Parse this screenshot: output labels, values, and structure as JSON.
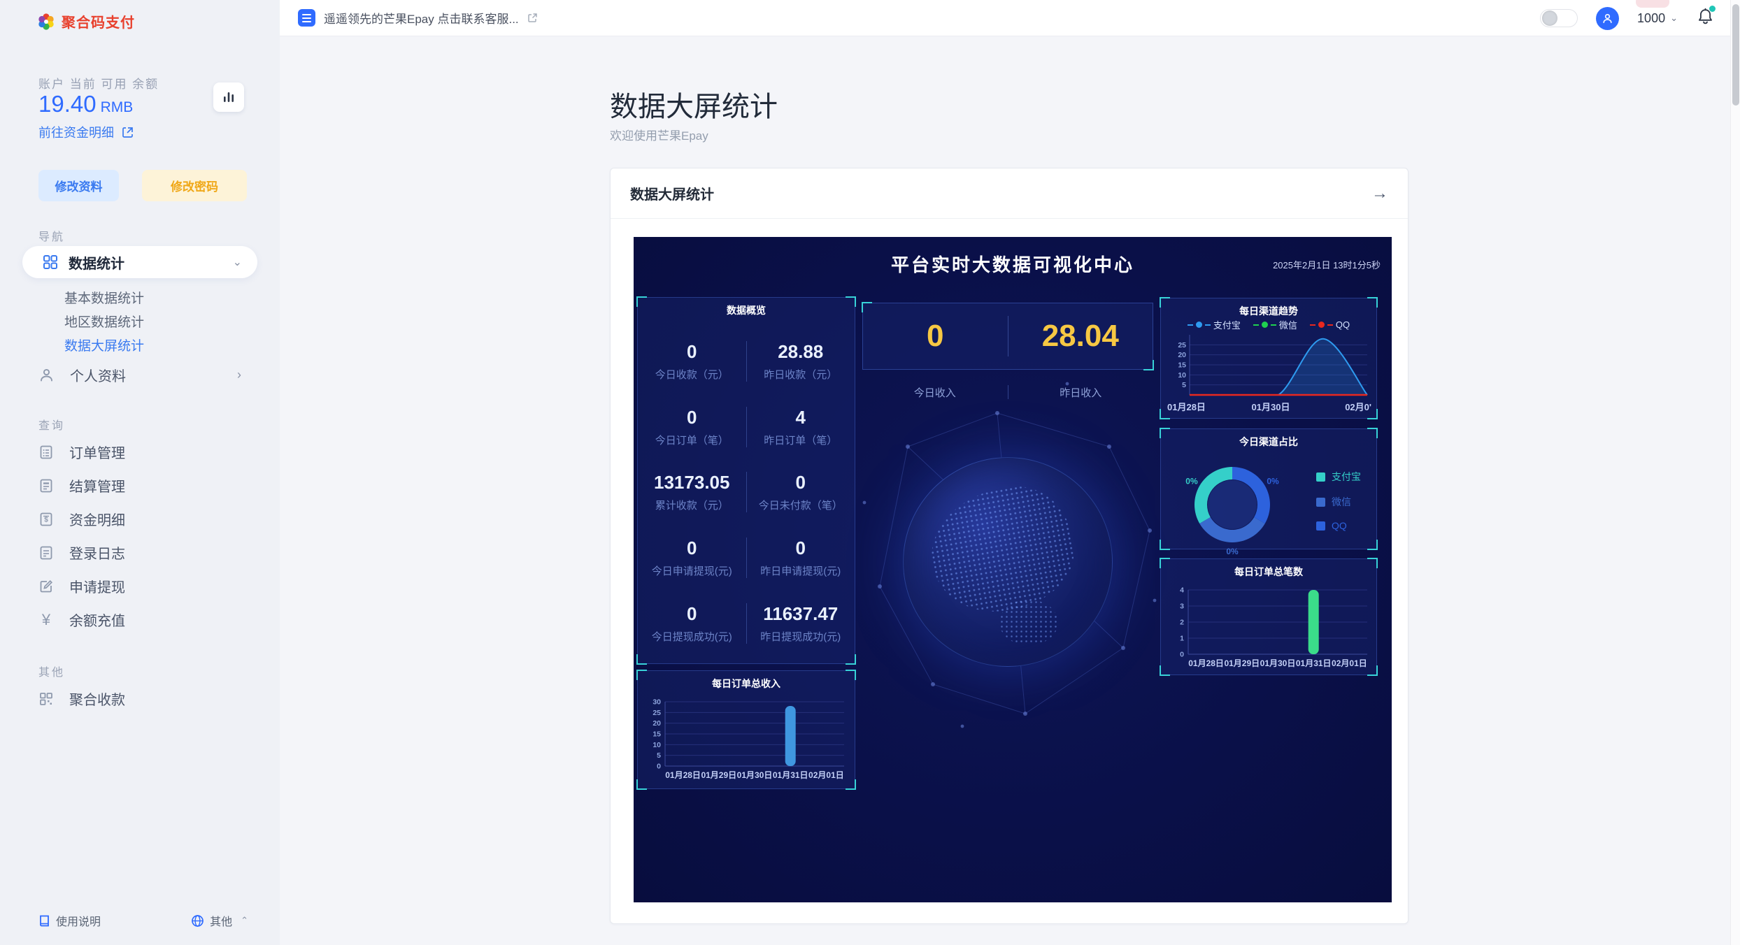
{
  "brand": {
    "logo_text": "聚合码支付"
  },
  "topbar": {
    "notice": "遥遥领先的芒果Epay 点击联系客服...",
    "user_id": "1000"
  },
  "sidebar": {
    "account_label": "账户 当前 可用 余额",
    "balance": "19.40",
    "currency": "RMB",
    "funds_link": "前往资金明细",
    "btn_profile": "修改资料",
    "btn_password": "修改密码",
    "nav_label": "导航",
    "nav_stats": "数据统计",
    "nav_sub": [
      "基本数据统计",
      "地区数据统计",
      "数据大屏统计"
    ],
    "nav_profile": "个人资料",
    "query_label": "查询",
    "query_items": [
      "订单管理",
      "结算管理",
      "资金明细",
      "登录日志",
      "申请提现",
      "余额充值"
    ],
    "other_label": "其他",
    "other_item": "聚合收款",
    "footer_help": "使用说明",
    "footer_other": "其他"
  },
  "page": {
    "title": "数据大屏统计",
    "subtitle": "欢迎使用芒果Epay",
    "card_title": "数据大屏统计",
    "card_arrow": "→"
  },
  "dashboard": {
    "title": "平台实时大数据可视化中心",
    "timestamp": "2025年2月1日 13时1分5秒",
    "overview_title": "数据概览",
    "overview_stats": [
      {
        "value": "0",
        "label": "今日收款（元）"
      },
      {
        "value": "28.88",
        "label": "昨日收款（元）"
      },
      {
        "value": "0",
        "label": "今日订单（笔）"
      },
      {
        "value": "4",
        "label": "昨日订单（笔）"
      },
      {
        "value": "13173.05",
        "label": "累计收款（元）"
      },
      {
        "value": "0",
        "label": "今日未付款（笔）"
      },
      {
        "value": "0",
        "label": "今日申请提现(元)"
      },
      {
        "value": "0",
        "label": "昨日申请提现(元)"
      },
      {
        "value": "0",
        "label": "今日提现成功(元)"
      },
      {
        "value": "11637.47",
        "label": "昨日提现成功(元)"
      }
    ],
    "income": {
      "today_value": "0",
      "today_label": "今日收入",
      "yesterday_value": "28.04",
      "yesterday_label": "昨日收入"
    },
    "accent_colors": {
      "corner_bracket": "#38d2d8",
      "number_yellow": "#f7c843",
      "background": "#0a1049"
    }
  },
  "chart_data": [
    {
      "type": "line",
      "title": "每日渠道趋势",
      "x": [
        "01月28日",
        "01月29日",
        "01月30日",
        "01月31日",
        "02月01日"
      ],
      "visible_x_ticks": [
        "01月28日",
        "01月30日",
        "02月0'"
      ],
      "series": [
        {
          "name": "支付宝",
          "color": "#2e9bf0",
          "values": [
            0,
            0,
            0,
            28,
            0
          ]
        },
        {
          "name": "微信",
          "color": "#1fd14f",
          "values": [
            0,
            0,
            0,
            0,
            0
          ]
        },
        {
          "name": "QQ",
          "color": "#e8281f",
          "values": [
            0,
            0,
            0,
            0,
            0
          ]
        }
      ],
      "ylim": [
        0,
        30
      ],
      "yticks": [
        5,
        10,
        15,
        20,
        25
      ],
      "grid": true,
      "legend_position": "top"
    },
    {
      "type": "pie",
      "title": "今日渠道占比",
      "labels": [
        "支付宝",
        "微信",
        "QQ"
      ],
      "values": [
        0,
        0,
        0
      ],
      "percent_labels": [
        "0%",
        "0%",
        "0%"
      ],
      "colors": [
        "#35cfc9",
        "#3a6ace",
        "#2d62dd"
      ],
      "start_angles": [
        240,
        120,
        0
      ],
      "end_angles": [
        360,
        240,
        120
      ],
      "donut": true,
      "legend_position": "right"
    },
    {
      "type": "bar",
      "title": "每日订单总笔数",
      "categories": [
        "01月28日",
        "01月29日",
        "01月30日",
        "01月31日",
        "02月01日"
      ],
      "values": [
        0,
        0,
        0,
        4,
        0
      ],
      "bar_color": "#3bdc8a",
      "ylim": [
        0,
        4
      ],
      "yticks": [
        0,
        1,
        2,
        3,
        4
      ],
      "grid": true
    },
    {
      "type": "bar",
      "title": "每日订单总收入",
      "categories": [
        "01月28日",
        "01月29日",
        "01月30日",
        "01月31日",
        "02月01日"
      ],
      "values": [
        0,
        0,
        0,
        28.04,
        0
      ],
      "bar_color": "#3f97e0",
      "ylim": [
        0,
        30
      ],
      "yticks": [
        0,
        5,
        10,
        15,
        20,
        25,
        30
      ],
      "grid": true
    }
  ]
}
